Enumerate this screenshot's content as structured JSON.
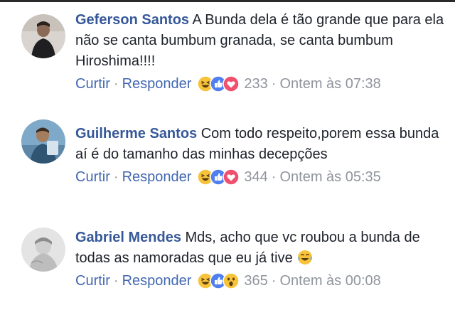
{
  "comments": [
    {
      "author": "Geferson Santos",
      "text": "A Bunda dela é tão grande que para ela não se canta bumbum granada, se canta bumbum Hiroshima!!!!",
      "like": "Curtir",
      "reply": "Responder",
      "sep": "·",
      "reactions": [
        "haha-icon",
        "like-icon",
        "love-icon"
      ],
      "reaction_count": "233",
      "time": "Ontem às 07:38"
    },
    {
      "author": "Guilherme Santos",
      "text": "Com todo respeito,porem essa bunda aí é do tamanho das minhas decepções",
      "like": "Curtir",
      "reply": "Responder",
      "sep": "·",
      "reactions": [
        "haha-icon",
        "like-icon",
        "love-icon"
      ],
      "reaction_count": "344",
      "time": "Ontem às 05:35"
    },
    {
      "author": "Gabriel Mendes",
      "text": "Mds, acho que vc roubou a bunda de todas as namoradas que eu já tive",
      "inline_emoji": "tears-of-joy-emoji",
      "like": "Curtir",
      "reply": "Responder",
      "sep": "·",
      "reactions": [
        "haha-icon",
        "like-icon",
        "wow-icon"
      ],
      "reaction_count": "365",
      "time": "Ontem às 00:08"
    }
  ],
  "colors": {
    "author": "#365899",
    "link": "#4267b2",
    "meta": "#90949c",
    "text": "#1d2129"
  }
}
